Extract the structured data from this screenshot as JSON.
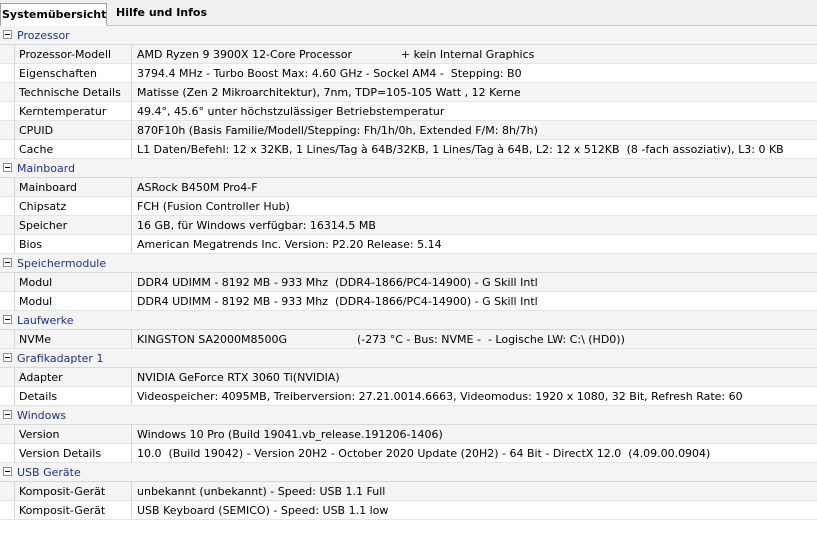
{
  "tabs": [
    {
      "label": "Systemübersicht",
      "active": true
    },
    {
      "label": "Hilfe und Infos",
      "active": false
    }
  ],
  "sections": [
    {
      "title": "Prozessor",
      "rows": [
        {
          "label": "Prozessor-Modell",
          "value": "AMD Ryzen 9 3900X 12-Core Processor              + kein Internal Graphics"
        },
        {
          "label": "Eigenschaften",
          "value": "3794.4 MHz - Turbo Boost Max: 4.60 GHz - Sockel AM4 -  Stepping: B0"
        },
        {
          "label": "Technische Details",
          "value": "Matisse (Zen 2 Mikroarchitektur), 7nm, TDP=105-105 Watt , 12 Kerne"
        },
        {
          "label": "Kerntemperatur",
          "value": "49.4°, 45.6° unter höchstzulässiger Betriebstemperatur"
        },
        {
          "label": "CPUID",
          "value": "870F10h (Basis Familie/Modell/Stepping: Fh/1h/0h, Extended F/M: 8h/7h)"
        },
        {
          "label": "Cache",
          "value": "L1 Daten/Befehl: 12 x 32KB, 1 Lines/Tag à 64B/32KB, 1 Lines/Tag à 64B, L2: 12 x 512KB  (8 -fach assoziativ), L3: 0 KB"
        }
      ]
    },
    {
      "title": "Mainboard",
      "rows": [
        {
          "label": "Mainboard",
          "value": "ASRock B450M Pro4-F"
        },
        {
          "label": "Chipsatz",
          "value": "FCH (Fusion Controller Hub)"
        },
        {
          "label": "Speicher",
          "value": "16 GB, für Windows verfügbar: 16314.5 MB"
        },
        {
          "label": "Bios",
          "value": "American Megatrends Inc. Version: P2.20 Release: 5.14"
        }
      ]
    },
    {
      "title": "Speichermodule",
      "rows": [
        {
          "label": "Modul",
          "value": "DDR4 UDIMM - 8192 MB - 933 Mhz  (DDR4-1866/PC4-14900) - G Skill Intl"
        },
        {
          "label": "Modul",
          "value": "DDR4 UDIMM - 8192 MB - 933 Mhz  (DDR4-1866/PC4-14900) - G Skill Intl"
        }
      ]
    },
    {
      "title": "Laufwerke",
      "rows": [
        {
          "label": "NVMe",
          "value": "KINGSTON SA2000M8500G                    (-273 °C - Bus: NVME -  - Logische LW: C:\\ (HD0))"
        }
      ]
    },
    {
      "title": "Grafikadapter 1",
      "rows": [
        {
          "label": "Adapter",
          "value": "NVIDIA GeForce RTX 3060 Ti(NVIDIA)"
        },
        {
          "label": "Details",
          "value": "Videospeicher: 4095MB, Treiberversion: 27.21.0014.6663, Videomodus: 1920 x 1080, 32 Bit, Refresh Rate: 60"
        }
      ]
    },
    {
      "title": "Windows",
      "rows": [
        {
          "label": "Version",
          "value": "Windows 10 Pro (Build 19041.vb_release.191206-1406)"
        },
        {
          "label": "Version Details",
          "value": "10.0  (Build 19042) - Version 20H2 - October 2020 Update (20H2) - 64 Bit - DirectX 12.0  (4.09.00.0904)"
        }
      ]
    },
    {
      "title": "USB Geräte",
      "rows": [
        {
          "label": "Komposit-Gerät",
          "value": "unbekannt (unbekannt) - Speed: USB 1.1 Full"
        },
        {
          "label": "Komposit-Gerät",
          "value": "USB Keyboard (SEMICO) - Speed: USB 1.1 low"
        }
      ]
    }
  ]
}
